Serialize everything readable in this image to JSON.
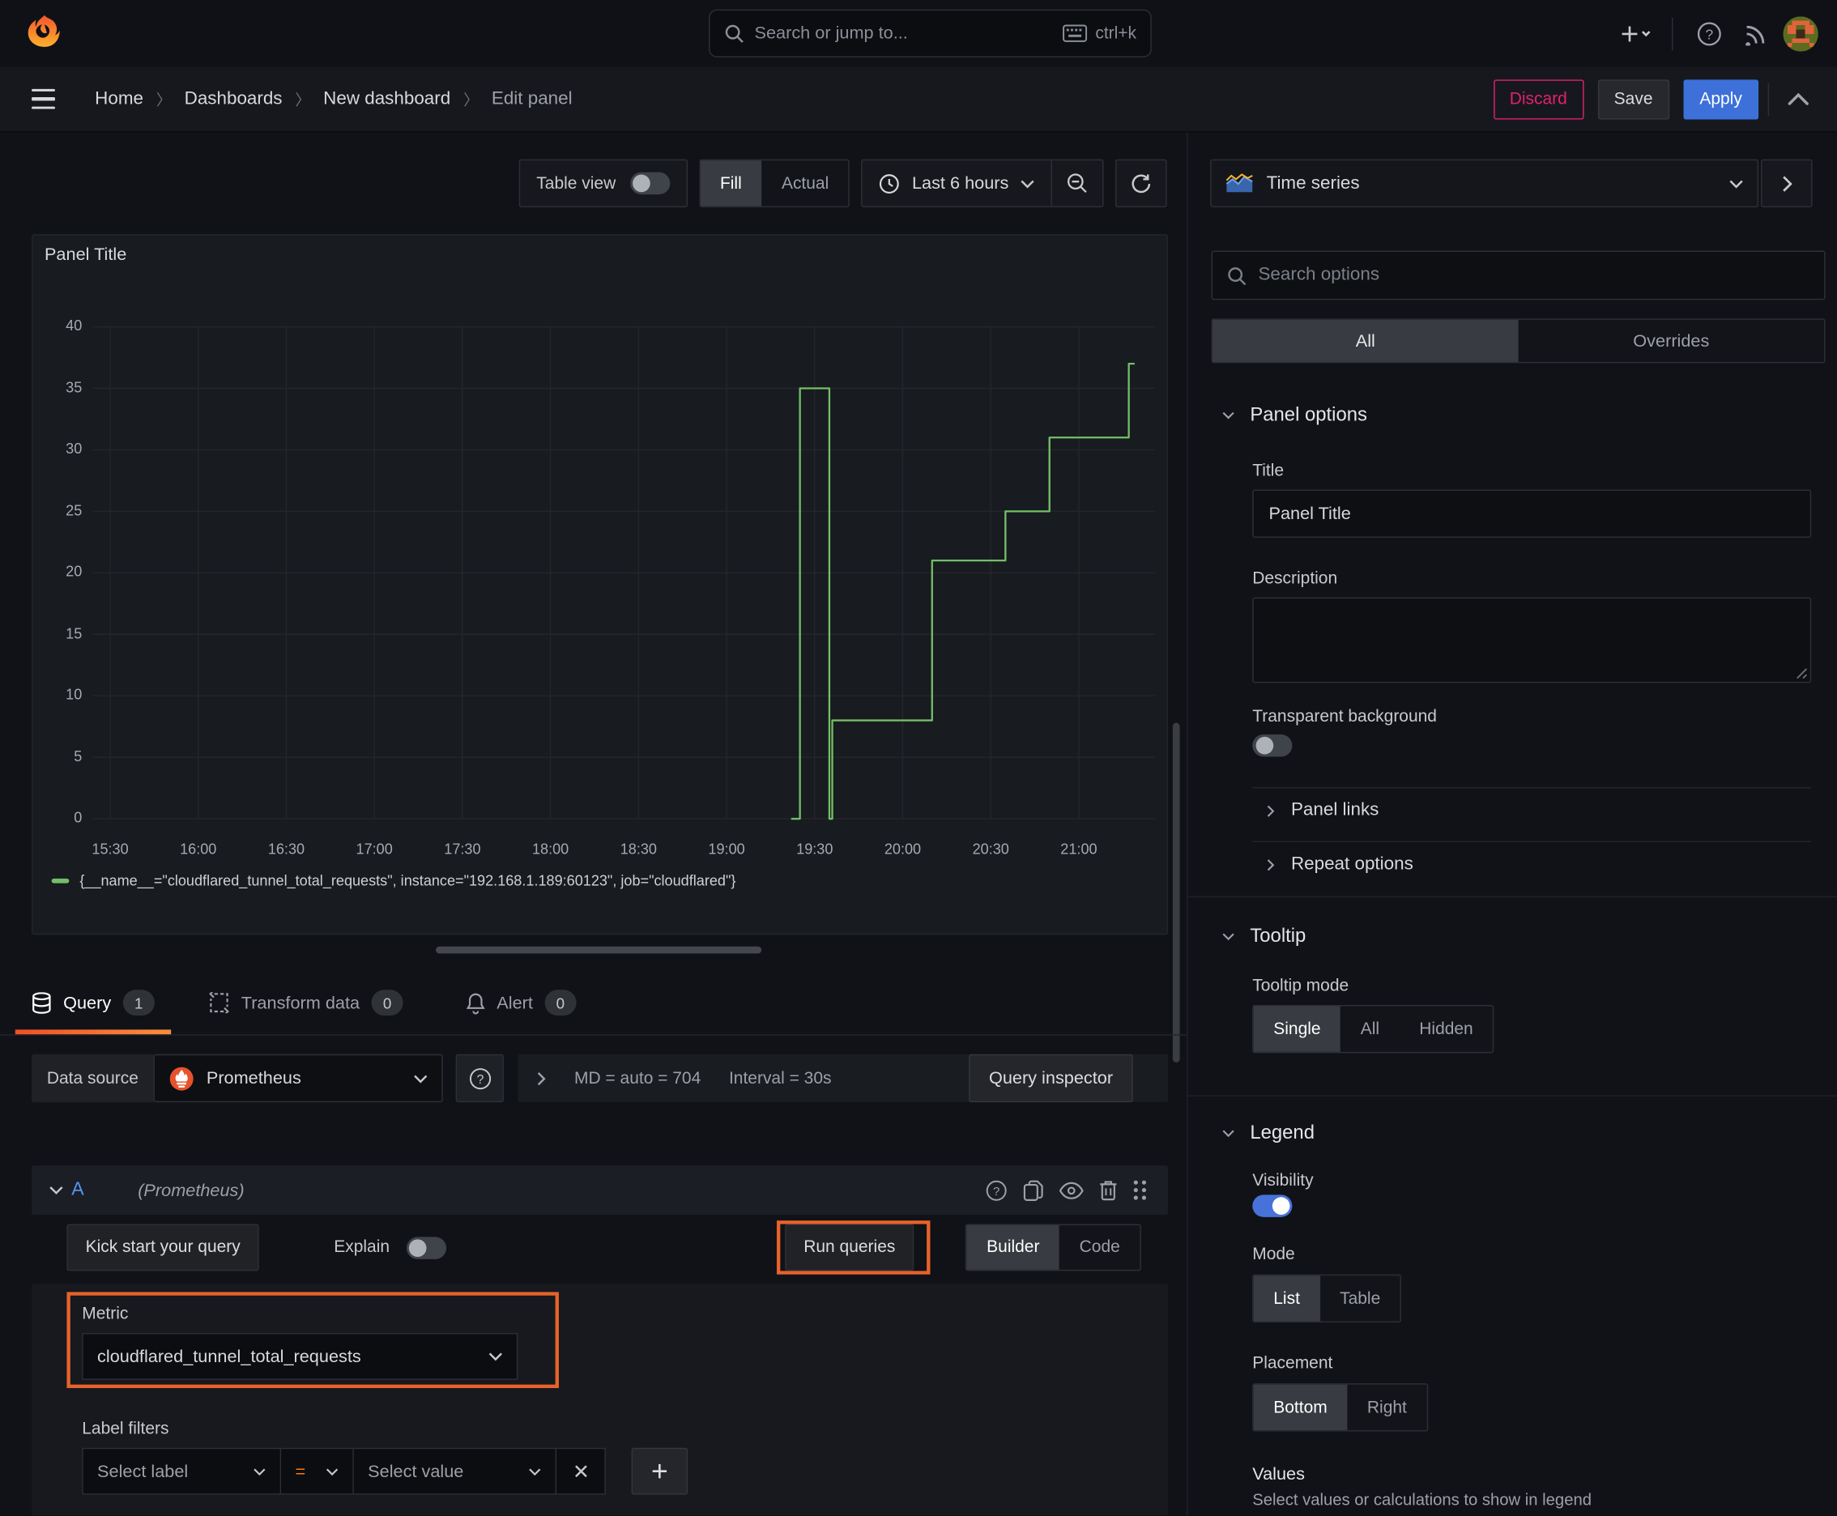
{
  "topbar": {
    "search_placeholder": "Search or jump to...",
    "search_shortcut": "ctrl+k"
  },
  "breadcrumb": {
    "items": [
      {
        "label": "Home"
      },
      {
        "label": "Dashboards"
      },
      {
        "label": "New dashboard"
      },
      {
        "label": "Edit panel"
      }
    ]
  },
  "actions": {
    "discard": "Discard",
    "save": "Save",
    "apply": "Apply"
  },
  "panel_toolbar": {
    "table_view": "Table view",
    "fill": "Fill",
    "actual": "Actual",
    "time_range": "Last 6 hours"
  },
  "panel": {
    "title": "Panel Title"
  },
  "query_tabs": {
    "query": "Query",
    "query_count": "1",
    "transform": "Transform data",
    "transform_count": "0",
    "alert": "Alert",
    "alert_count": "0"
  },
  "datasource_row": {
    "label": "Data source",
    "name": "Prometheus",
    "stats": "MD = auto = 704",
    "interval": "Interval = 30s",
    "inspector": "Query inspector"
  },
  "query_editor": {
    "ref_id": "A",
    "ds_hint": "(Prometheus)",
    "kickstart": "Kick start your query",
    "explain": "Explain",
    "run": "Run queries",
    "builder": "Builder",
    "code": "Code",
    "metric_label": "Metric",
    "metric_value": "cloudflared_tunnel_total_requests",
    "label_filters": "Label filters",
    "select_label": "Select label",
    "operator": "=",
    "select_value": "Select value"
  },
  "viz_picker": {
    "label": "Time series"
  },
  "options_search": {
    "placeholder": "Search options"
  },
  "options_tabs": {
    "all": "All",
    "overrides": "Overrides"
  },
  "panel_options": {
    "section": "Panel options",
    "title_label": "Title",
    "title_value": "Panel Title",
    "description_label": "Description",
    "transparent_label": "Transparent background",
    "panel_links": "Panel links",
    "repeat_options": "Repeat options"
  },
  "tooltip_section": {
    "title": "Tooltip",
    "mode_label": "Tooltip mode",
    "modes": [
      {
        "label": "Single"
      },
      {
        "label": "All"
      },
      {
        "label": "Hidden"
      }
    ]
  },
  "legend_section": {
    "title": "Legend",
    "visibility_label": "Visibility",
    "mode_label": "Mode",
    "modes": [
      {
        "label": "List"
      },
      {
        "label": "Table"
      }
    ],
    "placement_label": "Placement",
    "placements": [
      {
        "label": "Bottom"
      },
      {
        "label": "Right"
      }
    ],
    "values_label": "Values",
    "values_hint": "Select values or calculations to show in legend"
  },
  "chart_data": {
    "type": "line",
    "title": "Panel Title",
    "x_domain": [
      "15:24",
      "21:26"
    ],
    "y_domain": [
      0,
      40
    ],
    "x_ticks": [
      "15:30",
      "16:00",
      "16:30",
      "17:00",
      "17:30",
      "18:00",
      "18:30",
      "19:00",
      "19:30",
      "20:00",
      "20:30",
      "21:00"
    ],
    "y_ticks": [
      0,
      5,
      10,
      15,
      20,
      25,
      30,
      35,
      40
    ],
    "grid": true,
    "legend_position": "bottom",
    "series": [
      {
        "name": "{__name__=\"cloudflared_tunnel_total_requests\", instance=\"192.168.1.189:60123\", job=\"cloudflared\"}",
        "color": "#73bf69",
        "points": [
          [
            "19:22",
            0
          ],
          [
            "19:25",
            0
          ],
          [
            "19:25",
            35
          ],
          [
            "19:35",
            35
          ],
          [
            "19:35",
            0
          ],
          [
            "19:36",
            0
          ],
          [
            "19:36",
            8
          ],
          [
            "20:10",
            8
          ],
          [
            "20:10",
            21
          ],
          [
            "20:35",
            21
          ],
          [
            "20:35",
            25
          ],
          [
            "20:50",
            25
          ],
          [
            "20:50",
            31
          ],
          [
            "21:17",
            31
          ],
          [
            "21:17",
            37
          ],
          [
            "21:19",
            37
          ]
        ]
      }
    ]
  }
}
